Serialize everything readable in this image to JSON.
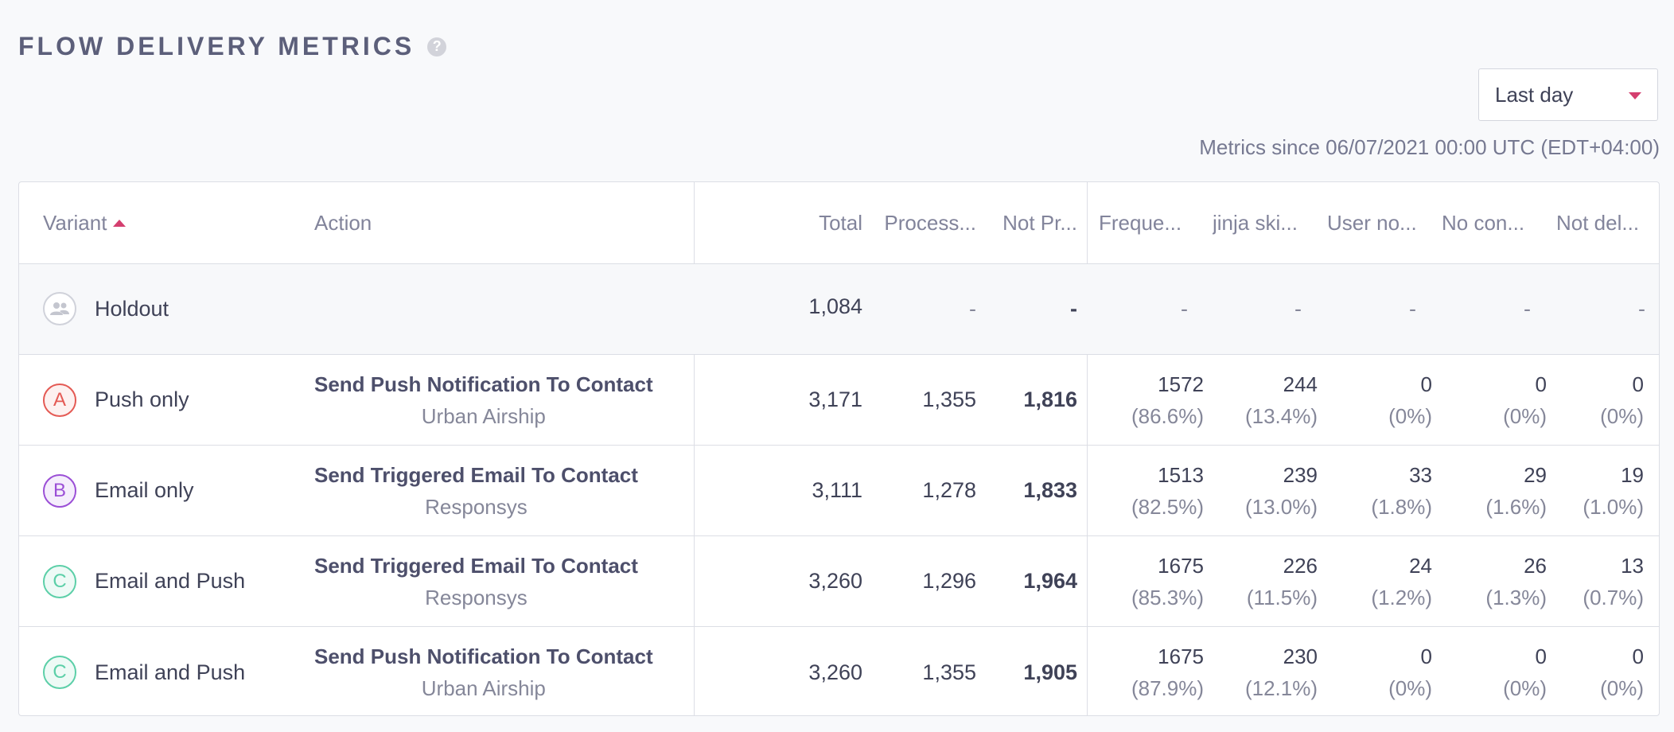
{
  "page": {
    "title": "FLOW DELIVERY METRICS",
    "help_icon": "?",
    "range_selected": "Last day",
    "since_text": "Metrics since 06/07/2021 00:00 UTC (EDT+04:00)"
  },
  "table": {
    "headers": {
      "variant": "Variant",
      "action": "Action",
      "total": "Total",
      "processed": "Process...",
      "not_processed": "Not Pr...",
      "frequency": "Freque...",
      "jinja": "jinja ski...",
      "user_not": "User no...",
      "no_contact": "No con...",
      "not_delivered": "Not del..."
    },
    "holdout": {
      "name": "Holdout",
      "total": "1,084",
      "processed": "-",
      "not_processed": "-",
      "frequency": "-",
      "jinja": "-",
      "user_not": "-",
      "no_contact": "-",
      "not_delivered": "-"
    },
    "rows": [
      {
        "badge": "A",
        "badge_style": "a",
        "name": "Push only",
        "action_title": "Send Push Notification To Contact",
        "action_sub": "Urban Airship",
        "total": "3,171",
        "processed": "1,355",
        "not_processed": "1,816",
        "frequency": {
          "v": "1572",
          "p": "(86.6%)"
        },
        "jinja": {
          "v": "244",
          "p": "(13.4%)"
        },
        "user_not": {
          "v": "0",
          "p": "(0%)"
        },
        "no_contact": {
          "v": "0",
          "p": "(0%)"
        },
        "not_delivered": {
          "v": "0",
          "p": "(0%)"
        }
      },
      {
        "badge": "B",
        "badge_style": "b",
        "name": "Email only",
        "action_title": "Send Triggered Email To Contact",
        "action_sub": "Responsys",
        "total": "3,111",
        "processed": "1,278",
        "not_processed": "1,833",
        "frequency": {
          "v": "1513",
          "p": "(82.5%)"
        },
        "jinja": {
          "v": "239",
          "p": "(13.0%)"
        },
        "user_not": {
          "v": "33",
          "p": "(1.8%)"
        },
        "no_contact": {
          "v": "29",
          "p": "(1.6%)"
        },
        "not_delivered": {
          "v": "19",
          "p": "(1.0%)"
        }
      },
      {
        "badge": "C",
        "badge_style": "c",
        "name": "Email and Push",
        "action_title": "Send Triggered Email To Contact",
        "action_sub": "Responsys",
        "total": "3,260",
        "processed": "1,296",
        "not_processed": "1,964",
        "frequency": {
          "v": "1675",
          "p": "(85.3%)"
        },
        "jinja": {
          "v": "226",
          "p": "(11.5%)"
        },
        "user_not": {
          "v": "24",
          "p": "(1.2%)"
        },
        "no_contact": {
          "v": "26",
          "p": "(1.3%)"
        },
        "not_delivered": {
          "v": "13",
          "p": "(0.7%)"
        }
      },
      {
        "badge": "C",
        "badge_style": "c",
        "name": "Email and Push",
        "action_title": "Send Push Notification To Contact",
        "action_sub": "Urban Airship",
        "total": "3,260",
        "processed": "1,355",
        "not_processed": "1,905",
        "frequency": {
          "v": "1675",
          "p": "(87.9%)"
        },
        "jinja": {
          "v": "230",
          "p": "(12.1%)"
        },
        "user_not": {
          "v": "0",
          "p": "(0%)"
        },
        "no_contact": {
          "v": "0",
          "p": "(0%)"
        },
        "not_delivered": {
          "v": "0",
          "p": "(0%)"
        }
      }
    ]
  },
  "colors": {
    "accent": "#d43f6f",
    "badge_a": "#e45a54",
    "badge_b": "#9b4fd6",
    "badge_c": "#5ccfa8"
  }
}
